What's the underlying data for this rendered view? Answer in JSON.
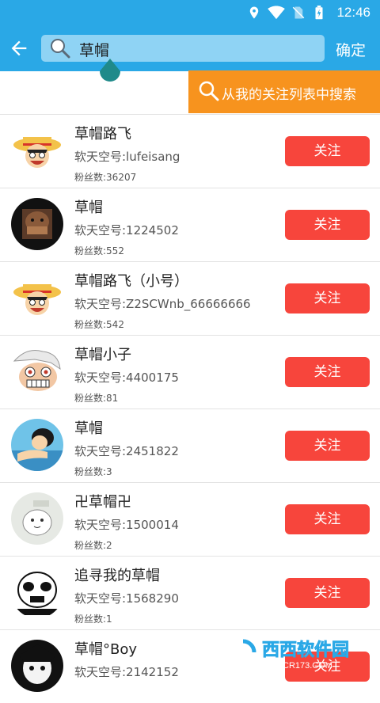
{
  "status_bar": {
    "time": "12:46",
    "icons": [
      "location-icon",
      "wifi-icon",
      "no-sim-icon",
      "battery-charging-icon"
    ]
  },
  "app_bar": {
    "search_value": "草帽",
    "confirm_label": "确定"
  },
  "follow_search": {
    "label": "从我的关注列表中搜索"
  },
  "follow_label": "关注",
  "results": [
    {
      "name": "草帽路飞",
      "uid_label": "软天空号:lufeisang",
      "fans_label": "粉丝数:36207"
    },
    {
      "name": "草帽",
      "uid_label": "软天空号:1224502",
      "fans_label": "粉丝数:552"
    },
    {
      "name": "草帽路飞（小号）",
      "uid_label": "软天空号:Z2SCWnb_66666666",
      "fans_label": "粉丝数:542"
    },
    {
      "name": "草帽小子",
      "uid_label": "软天空号:4400175",
      "fans_label": "粉丝数:81"
    },
    {
      "name": "草帽",
      "uid_label": "软天空号:2451822",
      "fans_label": "粉丝数:3"
    },
    {
      "name": "卍草帽卍",
      "uid_label": "软天空号:1500014",
      "fans_label": "粉丝数:2"
    },
    {
      "name": "追寻我的草帽",
      "uid_label": "软天空号:1568290",
      "fans_label": "粉丝数:1"
    },
    {
      "name": "草帽°Boy",
      "uid_label": "软天空号:2142152",
      "fans_label": ""
    }
  ],
  "watermark": {
    "text": "西西软件园",
    "sub": "CR173.COM"
  },
  "colors": {
    "primary": "#2aa8e6",
    "orange": "#f7931e",
    "follow_red": "#f7453c"
  }
}
